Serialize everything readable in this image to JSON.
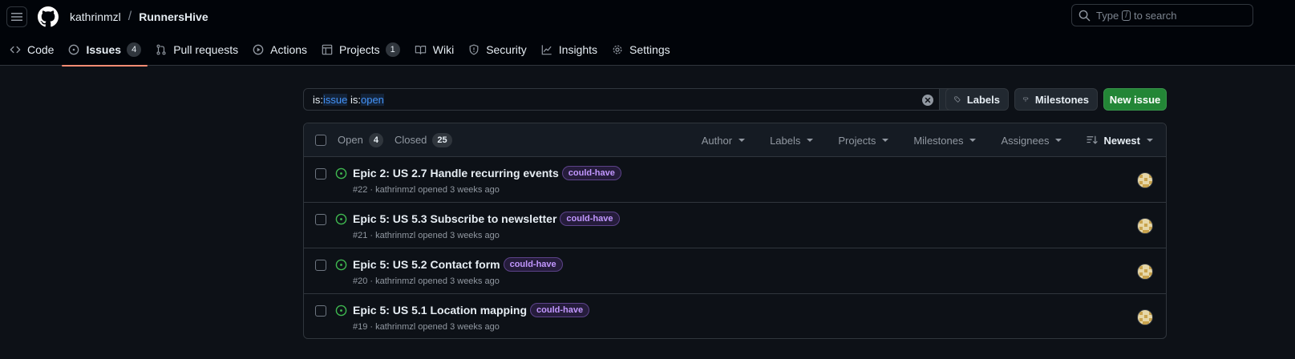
{
  "header": {
    "owner": "kathrinmzl",
    "separator": "/",
    "repo": "RunnersHive",
    "search": {
      "prefix": "Type",
      "key": "/",
      "suffix": "to search"
    }
  },
  "nav": {
    "items": [
      {
        "label": "Code",
        "icon": "code-icon"
      },
      {
        "label": "Issues",
        "icon": "issue-opened-icon",
        "count": "4",
        "active": true
      },
      {
        "label": "Pull requests",
        "icon": "git-pull-request-icon"
      },
      {
        "label": "Actions",
        "icon": "play-icon"
      },
      {
        "label": "Projects",
        "icon": "table-icon",
        "count": "1"
      },
      {
        "label": "Wiki",
        "icon": "book-icon"
      },
      {
        "label": "Security",
        "icon": "shield-icon"
      },
      {
        "label": "Insights",
        "icon": "graph-icon"
      },
      {
        "label": "Settings",
        "icon": "gear-icon"
      }
    ]
  },
  "toolbar": {
    "query": {
      "k1": "is:",
      "v1": "issue",
      "sp": " ",
      "k2": "is:",
      "v2": "open"
    },
    "labels_button": "Labels",
    "milestones_button": "Milestones",
    "new_issue_button": "New issue"
  },
  "list": {
    "open_label": "Open",
    "open_count": "4",
    "closed_label": "Closed",
    "closed_count": "25",
    "filters": [
      "Author",
      "Labels",
      "Projects",
      "Milestones",
      "Assignees"
    ],
    "sort_label": "Newest",
    "issues": [
      {
        "title": "Epic 2: US 2.7 Handle recurring events",
        "label": "could-have",
        "meta": "#22 · kathrinmzl opened 3 weeks ago"
      },
      {
        "title": "Epic 5: US 5.3 Subscribe to newsletter",
        "label": "could-have",
        "meta": "#21 · kathrinmzl opened 3 weeks ago"
      },
      {
        "title": "Epic 5: US 5.2 Contact form",
        "label": "could-have",
        "meta": "#20 · kathrinmzl opened 3 weeks ago"
      },
      {
        "title": "Epic 5: US 5.1 Location mapping",
        "label": "could-have",
        "meta": "#19 · kathrinmzl opened 3 weeks ago"
      }
    ]
  },
  "colors": {
    "background": "#0d1117",
    "header_bg": "#010409",
    "active_underline": "#fd8c73",
    "open_issue": "#3fb950",
    "new_issue_button": "#238636",
    "label_text": "#c297ff"
  }
}
